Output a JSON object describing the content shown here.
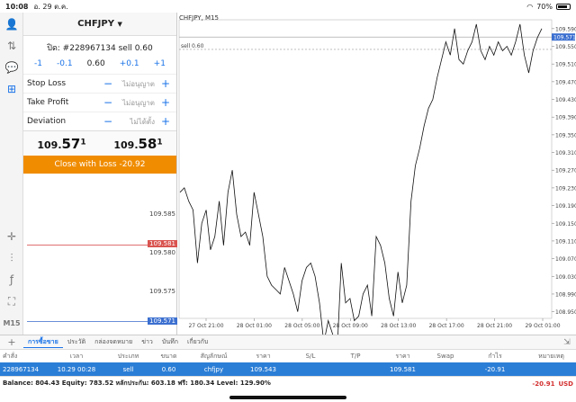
{
  "status_bar": {
    "time": "10:08",
    "date": "อ. 29 ต.ค.",
    "battery": "70%"
  },
  "order_panel": {
    "symbol": "CHFJPY",
    "ticket_text": "ปิด: #228967134 sell 0.60",
    "steps": {
      "m1": "-1",
      "m01": "-0.1",
      "volume": "0.60",
      "p01": "+0.1",
      "p1": "+1"
    },
    "stop_loss": {
      "label": "Stop Loss",
      "value": "ไม่อนุญาต"
    },
    "take_profit": {
      "label": "Take Profit",
      "value": "ไม่อนุญาต"
    },
    "deviation": {
      "label": "Deviation",
      "value": "ไม่ได้ตั้ง"
    },
    "bid": {
      "prefix": "109.",
      "big": "57",
      "sup": "1"
    },
    "ask": {
      "prefix": "109.",
      "big": "58",
      "sup": "1"
    },
    "close_button": "Close with Loss -20.92"
  },
  "mini_chart": {
    "levels": [
      "109.585",
      "109.580",
      "109.575"
    ],
    "ask_tag": "109.581",
    "bid_tag": "109.571"
  },
  "left_toolbar": {
    "timeframe": "M15"
  },
  "chart": {
    "title": "CHFJPY, M15",
    "order_label": "sell 0.60",
    "price_tag": "109.571",
    "y_ticks": [
      "109.590",
      "109.550",
      "109.510",
      "109.470",
      "109.430",
      "109.390",
      "109.350",
      "109.310",
      "109.270",
      "109.230",
      "109.190",
      "109.150",
      "109.110",
      "109.070",
      "109.030",
      "108.990",
      "108.950"
    ],
    "x_ticks": [
      "27 Oct 21:00",
      "28 Oct 01:00",
      "28 Oct 05:00",
      "28 Oct 09:00",
      "28 Oct 13:00",
      "28 Oct 17:00",
      "28 Oct 21:00",
      "29 Oct 01:00"
    ],
    "series": [
      109.22,
      109.23,
      109.2,
      109.18,
      109.06,
      109.15,
      109.18,
      109.09,
      109.12,
      109.2,
      109.1,
      109.22,
      109.27,
      109.17,
      109.12,
      109.13,
      109.1,
      109.22,
      109.17,
      109.12,
      109.03,
      109.01,
      109.0,
      108.99,
      109.05,
      109.02,
      108.99,
      108.95,
      109.02,
      109.05,
      109.06,
      109.03,
      108.97,
      108.88,
      108.93,
      108.9,
      108.85,
      109.06,
      108.97,
      108.98,
      108.93,
      108.94,
      108.99,
      109.01,
      108.94,
      109.12,
      109.1,
      109.06,
      108.98,
      108.94,
      109.04,
      108.97,
      109.01,
      109.2,
      109.28,
      109.32,
      109.37,
      109.41,
      109.43,
      109.48,
      109.52,
      109.56,
      109.53,
      109.59,
      109.52,
      109.51,
      109.54,
      109.56,
      109.6,
      109.54,
      109.52,
      109.55,
      109.53,
      109.56,
      109.54,
      109.55,
      109.53,
      109.56,
      109.6,
      109.53,
      109.49,
      109.54,
      109.57,
      109.59
    ],
    "order_level": 109.543
  },
  "bottom_tabs": [
    "การซื้อขาย",
    "ประวัติ",
    "กล่องจดหมาย",
    "ข่าว",
    "บันทึก",
    "เกี่ยวกับ"
  ],
  "table": {
    "headers": [
      "คำสั่ง",
      "เวลา",
      "ประเภท",
      "ขนาด",
      "สัญลักษณ์",
      "ราคา",
      "S/L",
      "T/P",
      "ราคา",
      "Swap",
      "กำไร",
      "หมายเหตุ"
    ],
    "row": [
      "228967134",
      "10.29 00:28",
      "sell",
      "0.60",
      "chfjpy",
      "109.543",
      "",
      "",
      "109.581",
      "",
      "-20.91",
      ""
    ]
  },
  "balance": {
    "text": "Balance: 804.43 Equity: 783.52 หลักประกัน: 603.18 ฟรี: 180.34 Level: 129.90%",
    "profit": "-20.91",
    "currency": "USD"
  },
  "colors": {
    "accent": "#1a73e8",
    "close_button": "#f08c00",
    "row_highlight": "#2b7ed6",
    "loss": "#d32f2f"
  }
}
